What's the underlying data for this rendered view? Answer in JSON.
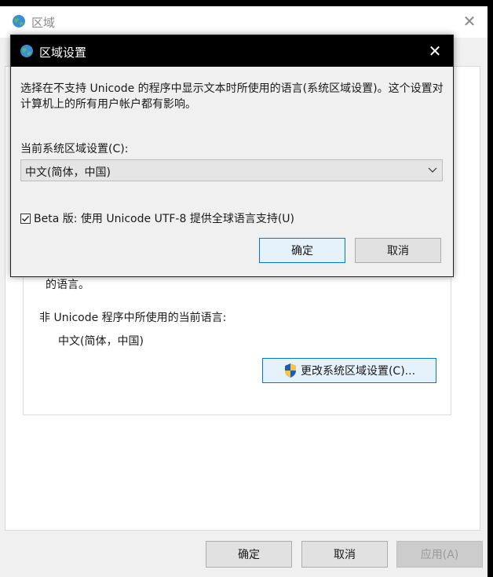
{
  "outer_window": {
    "title": "区域",
    "close_glyph": "✕",
    "group": {
      "partial_text": "的语言。",
      "label": "非 Unicode 程序中所使用的当前语言:",
      "value": "中文(简体，中国)",
      "change_button": "更改系统区域设置(C)..."
    },
    "buttons": {
      "ok": "确定",
      "cancel": "取消",
      "apply": "应用(A)"
    }
  },
  "inner_dialog": {
    "title": "区域设置",
    "close_glyph": "✕",
    "description": "选择在不支持 Unicode 的程序中显示文本时所使用的语言(系统区域设置)。这个设置对计算机上的所有用户帐户都有影响。",
    "current_label": "当前系统区域设置(C):",
    "current_value": "中文(简体，中国)",
    "beta_label": "Beta 版: 使用 Unicode UTF-8 提供全球语言支持(U)",
    "beta_checked": true,
    "buttons": {
      "ok": "确定",
      "cancel": "取消"
    }
  },
  "colors": {
    "accent": "#0078d7",
    "titlebar_active": "#000000",
    "dialog_bg": "#f0f0f0"
  },
  "icons": [
    "globe-icon",
    "close-icon",
    "chevron-down-icon",
    "checkbox-check-icon",
    "uac-shield-icon"
  ]
}
